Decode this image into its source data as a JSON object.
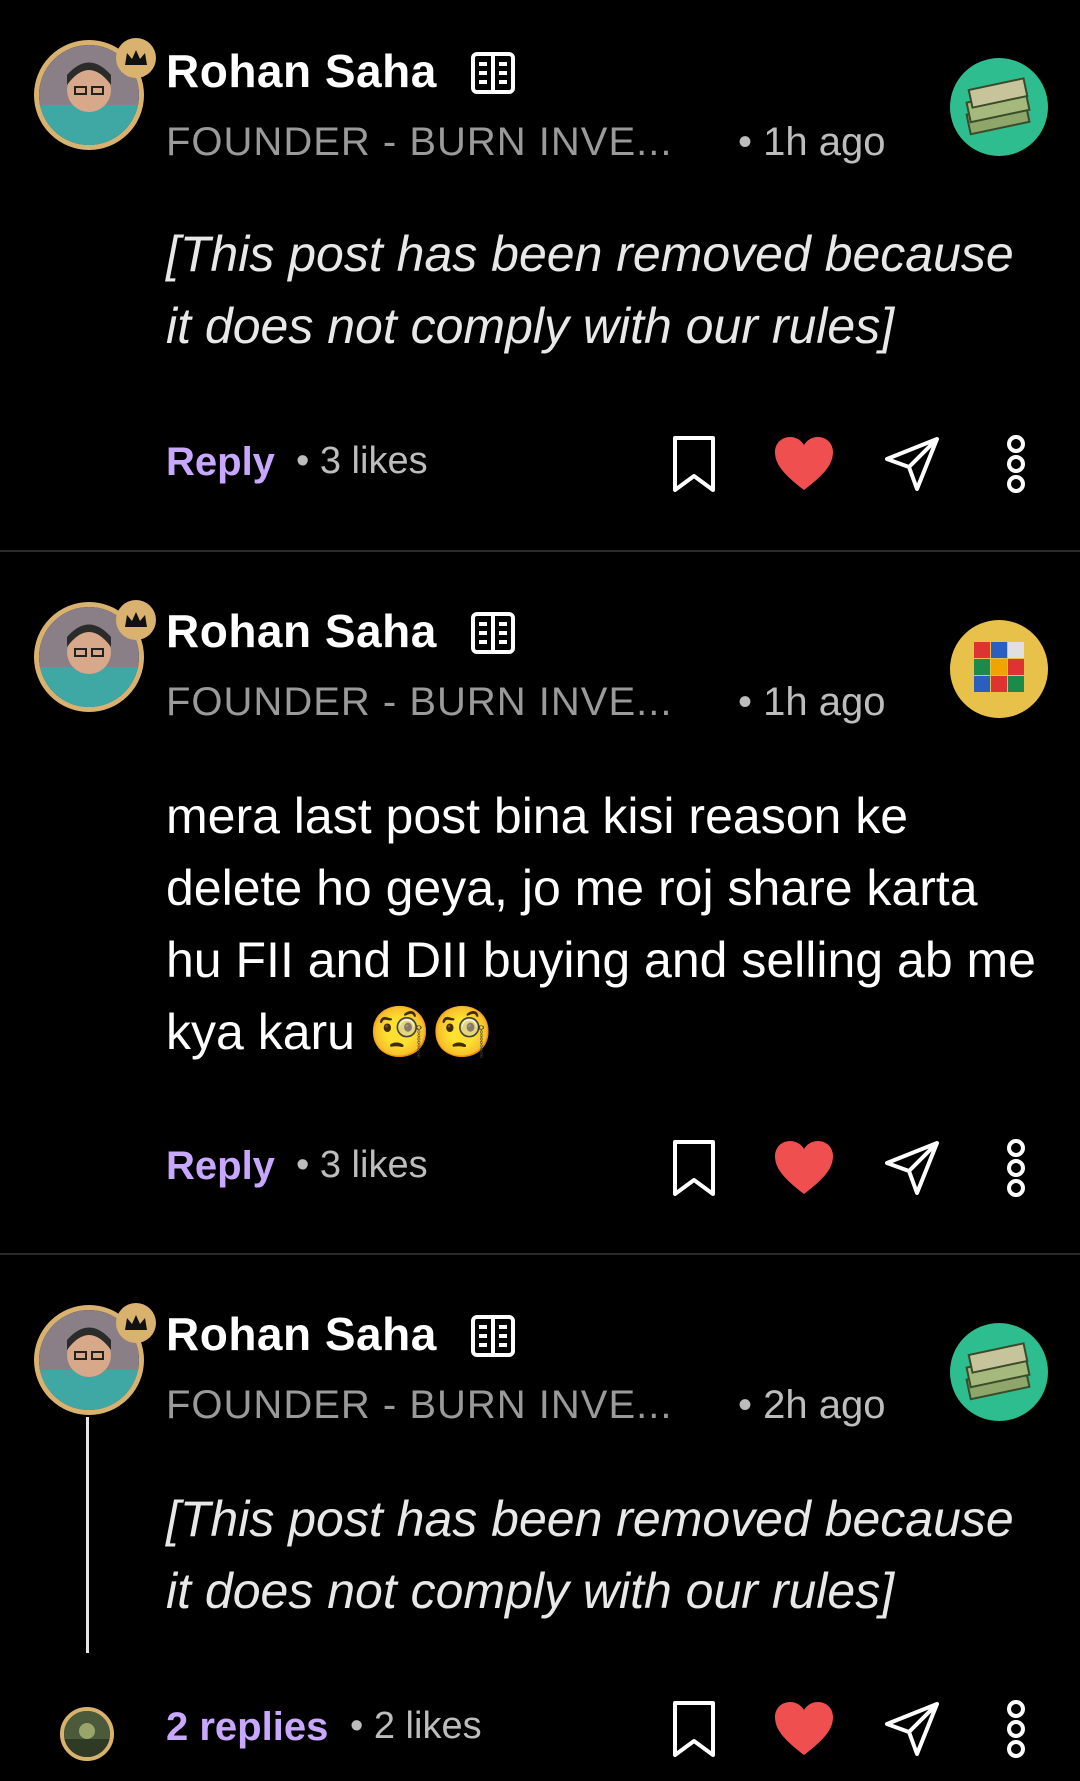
{
  "posts": [
    {
      "author": "Rohan Saha",
      "headline": "FOUNDER - BURN INVE...",
      "time": "• 1h ago",
      "body": "[This post has been removed because it does not comply with our rules]",
      "removed": true,
      "reply_label": "Reply",
      "likes": "• 3 likes",
      "award_icon": "money-stack-icon",
      "award_color": "#2ebd8f"
    },
    {
      "author": "Rohan Saha",
      "headline": "FOUNDER - BURN INVE...",
      "time": "• 1h ago",
      "body": "mera last post bina kisi reason ke delete ho geya, jo me roj share karta hu FII and DII buying and selling ab me kya karu 🧐🧐",
      "removed": false,
      "reply_label": "Reply",
      "likes": "• 3 likes",
      "award_icon": "rubiks-cube-icon",
      "award_color": "#e8c14a"
    },
    {
      "author": "Rohan Saha",
      "headline": "FOUNDER - BURN INVE...",
      "time": "• 2h ago",
      "body": "[This post has been removed because it does not comply with our rules]",
      "removed": true,
      "reply_label": "2 replies",
      "likes": "• 2 likes",
      "award_icon": "money-stack-icon",
      "award_color": "#2ebd8f"
    }
  ],
  "colors": {
    "background": "#000000",
    "accent_link": "#c8a8ff",
    "heart": "#ef4f4f",
    "avatar_ring": "#d9b26f"
  }
}
